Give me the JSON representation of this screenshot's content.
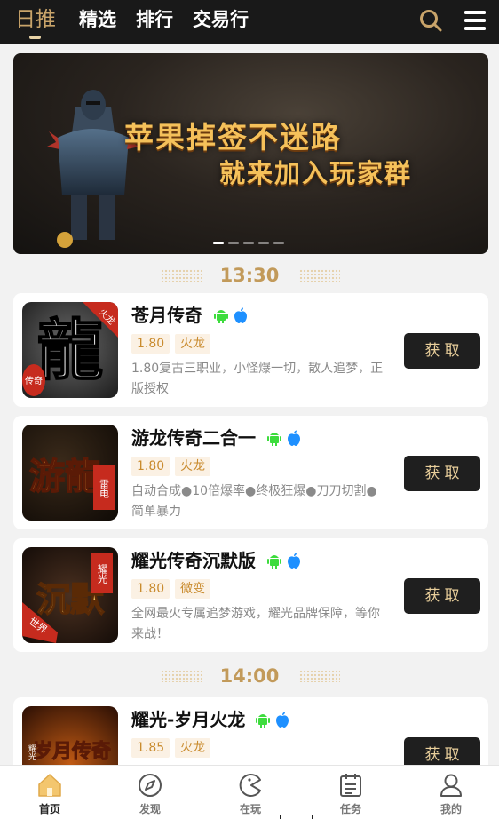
{
  "header": {
    "tabs": [
      {
        "label": "日推",
        "active": true
      },
      {
        "label": "精选",
        "active": false
      },
      {
        "label": "排行",
        "active": false
      },
      {
        "label": "交易行",
        "active": false
      }
    ],
    "icons": [
      "search-icon",
      "menu-icon"
    ]
  },
  "banner": {
    "line1": "苹果掉签不迷路",
    "line2": "就来加入玩家群",
    "dot_count": 5,
    "active_dot": 0
  },
  "sections": [
    {
      "time": "13:30",
      "games": [
        {
          "name": "苍月传奇",
          "tags": [
            "1.80",
            "火龙"
          ],
          "desc": "1.80复古三职业，小怪爆一切，散人追梦，正版授权",
          "button": "获取",
          "thumb_char": "龍",
          "thumb_side": "火龙",
          "thumb_corner": "传奇"
        },
        {
          "name": "游龙传奇二合一",
          "tags": [
            "1.80",
            "火龙"
          ],
          "desc": "自动合成●10倍爆率●终极狂爆●刀刀切割●简单暴力",
          "button": "获取",
          "thumb_char": "游龍",
          "thumb_side": "雷电"
        },
        {
          "name": "耀光传奇沉默版",
          "tags": [
            "1.80",
            "微变"
          ],
          "desc": "全网最火专属追梦游戏，耀光品牌保障，等你来战！",
          "button": "获取",
          "thumb_char": "沉默",
          "thumb_side": "耀光",
          "thumb_corner": "世界"
        }
      ]
    },
    {
      "time": "14:00",
      "games": [
        {
          "name": "耀光-岁月火龙",
          "tags": [
            "1.85",
            "火龙"
          ],
          "button": "获取",
          "thumb_char": "岁月传奇",
          "thumb_side": "耀光"
        }
      ]
    }
  ],
  "tabbar": [
    {
      "label": "首页",
      "icon": "home-icon",
      "active": true
    },
    {
      "label": "发现",
      "icon": "compass-icon",
      "active": false
    },
    {
      "label": "在玩",
      "icon": "pacman-icon",
      "active": false
    },
    {
      "label": "任务",
      "icon": "calendar-icon",
      "active": false
    },
    {
      "label": "我的",
      "icon": "user-icon",
      "active": false
    }
  ],
  "colors": {
    "header_bg": "#191919",
    "accent_gold": "#c9a46a",
    "button_bg": "#1f1f1f",
    "button_text": "#e9cf9b",
    "tag_text": "#c98b2e",
    "android_green": "#3ddc3d",
    "apple_blue": "#1e90ff"
  }
}
